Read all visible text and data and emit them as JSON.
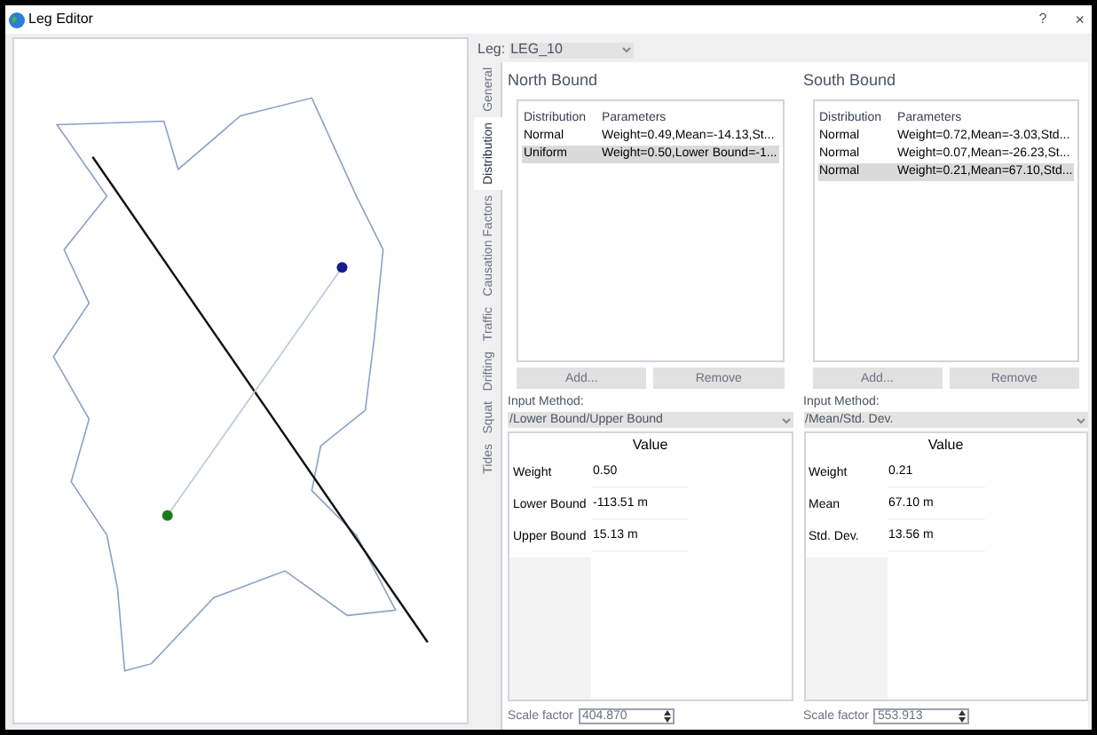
{
  "window": {
    "title": "Leg Editor",
    "help": "?",
    "close": "×"
  },
  "leg": {
    "label": "Leg:",
    "value": "LEG_10"
  },
  "tabs": [
    {
      "label": "General",
      "selected": false
    },
    {
      "label": "Distribution",
      "selected": true
    },
    {
      "label": "Causation Factors",
      "selected": false
    },
    {
      "label": "Traffic",
      "selected": false
    },
    {
      "label": "Drifting",
      "selected": false
    },
    {
      "label": "Squat",
      "selected": false
    },
    {
      "label": "Tides",
      "selected": false
    }
  ],
  "panels": [
    {
      "title": "North Bound",
      "columns": [
        "Distribution",
        "Parameters"
      ],
      "rows": [
        {
          "distribution": "Normal",
          "parameters": "Weight=0.49,Mean=-14.13,St...",
          "selected": false
        },
        {
          "distribution": "Uniform",
          "parameters": "Weight=0.50,Lower Bound=-1...",
          "selected": true
        }
      ],
      "buttons": [
        "Add...",
        "Remove"
      ],
      "input_method_label": "Input Method:",
      "input_method": "/Lower Bound/Upper Bound",
      "value_header": "Value",
      "values": [
        {
          "label": "Weight",
          "value": "0.50"
        },
        {
          "label": "Lower Bound",
          "value": "-113.51 m"
        },
        {
          "label": "Upper Bound",
          "value": "15.13 m"
        }
      ],
      "scale_label": "Scale factor",
      "scale_value": "404.870"
    },
    {
      "title": "South Bound",
      "columns": [
        "Distribution",
        "Parameters"
      ],
      "rows": [
        {
          "distribution": "Normal",
          "parameters": "Weight=0.72,Mean=-3.03,Std...",
          "selected": false
        },
        {
          "distribution": "Normal",
          "parameters": "Weight=0.07,Mean=-26.23,St...",
          "selected": false
        },
        {
          "distribution": "Normal",
          "parameters": "Weight=0.21,Mean=67.10,Std...",
          "selected": true
        }
      ],
      "buttons": [
        "Add...",
        "Remove"
      ],
      "input_method_label": "Input Method:",
      "input_method": "/Mean/Std. Dev.",
      "value_header": "Value",
      "values": [
        {
          "label": "Weight",
          "value": "0.21"
        },
        {
          "label": "Mean",
          "value": "67.10 m"
        },
        {
          "label": "Std. Dev.",
          "value": "13.56 m"
        }
      ],
      "scale_label": "Scale factor",
      "scale_value": "553.913"
    }
  ]
}
